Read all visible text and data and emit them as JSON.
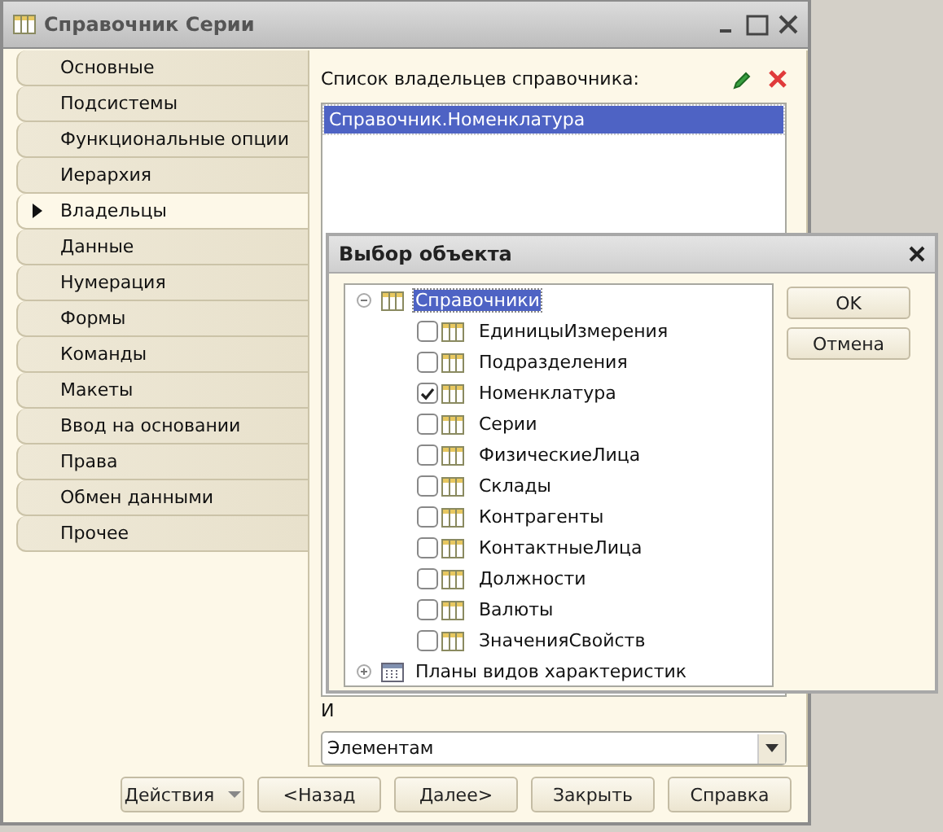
{
  "window": {
    "title": "Справочник Серии"
  },
  "tabs": [
    {
      "label": "Основные",
      "selected": false
    },
    {
      "label": "Подсистемы",
      "selected": false
    },
    {
      "label": "Функциональные опции",
      "selected": false
    },
    {
      "label": "Иерархия",
      "selected": false
    },
    {
      "label": "Владельцы",
      "selected": true
    },
    {
      "label": "Данные",
      "selected": false
    },
    {
      "label": "Нумерация",
      "selected": false
    },
    {
      "label": "Формы",
      "selected": false
    },
    {
      "label": "Команды",
      "selected": false
    },
    {
      "label": "Макеты",
      "selected": false
    },
    {
      "label": "Ввод на основании",
      "selected": false
    },
    {
      "label": "Права",
      "selected": false
    },
    {
      "label": "Обмен данными",
      "selected": false
    },
    {
      "label": "Прочее",
      "selected": false
    }
  ],
  "owners": {
    "label": "Список владельцев справочника:",
    "items": [
      {
        "label": "Справочник.Номенклатура",
        "selected": true
      }
    ]
  },
  "usage": {
    "label": "И",
    "value": "Элементам"
  },
  "buttons": [
    {
      "label": "Действия",
      "kind": "menu"
    },
    {
      "label": "<Назад",
      "kind": "plain"
    },
    {
      "label": "Далее>",
      "kind": "plain"
    },
    {
      "label": "Закрыть",
      "kind": "plain"
    },
    {
      "label": "Справка",
      "kind": "plain"
    }
  ],
  "dialog": {
    "title": "Выбор объекта",
    "tree": [
      {
        "label": "Справочники",
        "kind": "catalog",
        "expanded": true,
        "selected": true,
        "children": [
          {
            "label": "ЕдиницыИзмерения",
            "checked": false,
            "selected": false
          },
          {
            "label": "Подразделения",
            "checked": false,
            "selected": false
          },
          {
            "label": "Номенклатура",
            "checked": true,
            "selected": false
          },
          {
            "label": "Серии",
            "checked": false,
            "selected": false
          },
          {
            "label": "ФизическиеЛица",
            "checked": false,
            "selected": false
          },
          {
            "label": "Склады",
            "checked": false,
            "selected": false
          },
          {
            "label": "Контрагенты",
            "checked": false,
            "selected": false
          },
          {
            "label": "КонтактныеЛица",
            "checked": false,
            "selected": false
          },
          {
            "label": "Должности",
            "checked": false,
            "selected": false
          },
          {
            "label": "Валюты",
            "checked": false,
            "selected": false
          },
          {
            "label": "ЗначенияСвойств",
            "checked": false,
            "selected": false
          }
        ]
      },
      {
        "label": "Планы видов характеристик",
        "kind": "chart-plan",
        "expanded": false,
        "selected": false
      }
    ],
    "buttons": [
      "OK",
      "Отмена"
    ]
  }
}
